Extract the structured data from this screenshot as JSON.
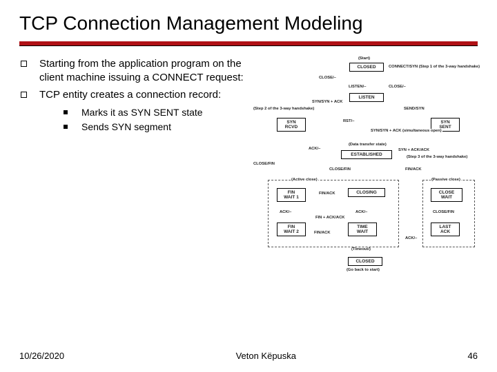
{
  "title": "TCP Connection Management Modeling",
  "bullets": {
    "0": "Starting from the application program on the client machine issuing a CONNECT request:",
    "1": "TCP entity creates a connection record:"
  },
  "subbullets": {
    "0": "Marks it as SYN SENT state",
    "1": "Sends SYN segment"
  },
  "diagram": {
    "states": {
      "closed_top": "CLOSED",
      "listen": "LISTEN",
      "syn_rcvd": "SYN\nRCVD",
      "syn_sent": "SYN\nSENT",
      "established": "ESTABLISHED",
      "fin_wait_1": "FIN\nWAIT 1",
      "fin_wait_2": "FIN\nWAIT 2",
      "closing": "CLOSING",
      "time_wait": "TIME\nWAIT",
      "close_wait": "CLOSE\nWAIT",
      "last_ack": "LAST\nACK",
      "closed_bottom": "CLOSED"
    },
    "labels": {
      "start": "(Start)",
      "connect_syn": "CONNECT/SYN (Step 1 of the 3-way handshake)",
      "close_top": "CLOSE/–",
      "listen_l": "LISTEN/–",
      "close_l": "CLOSE/–",
      "syn_syn_ack": "SYN/SYN + ACK",
      "step2": "(Step 2 of the 3-way handshake)",
      "rst": "RST/–",
      "send_syn": "SEND/SYN",
      "syn_syn_ack2": "SYN/SYN + ACK (simultaneous open)",
      "ack": "ACK/–",
      "data_transfer": "(Data transfer state)",
      "syn_ack_ack": "SYN + ACK/ACK",
      "step3": "(Step 3 of the 3-way handshake)",
      "close_fin_l": "CLOSE/FIN",
      "close_fin_c": "CLOSE/FIN",
      "fin_ack_r": "FIN/ACK",
      "active_close": "(Active close)",
      "passive_close": "(Passive close)",
      "fin_ack_c": "FIN/ACK",
      "ack2": "ACK/–",
      "fin_ack_ack": "FIN + ACK/ACK",
      "ack3": "ACK/–",
      "close_fin_r": "CLOSE/FIN",
      "fin_ack_b": "FIN/ACK",
      "ack4": "ACK/–",
      "timeout": "(Timeout/)",
      "go_back": "(Go back to start)"
    }
  },
  "footer": {
    "date": "10/26/2020",
    "author": "Veton Këpuska",
    "page": "46"
  }
}
